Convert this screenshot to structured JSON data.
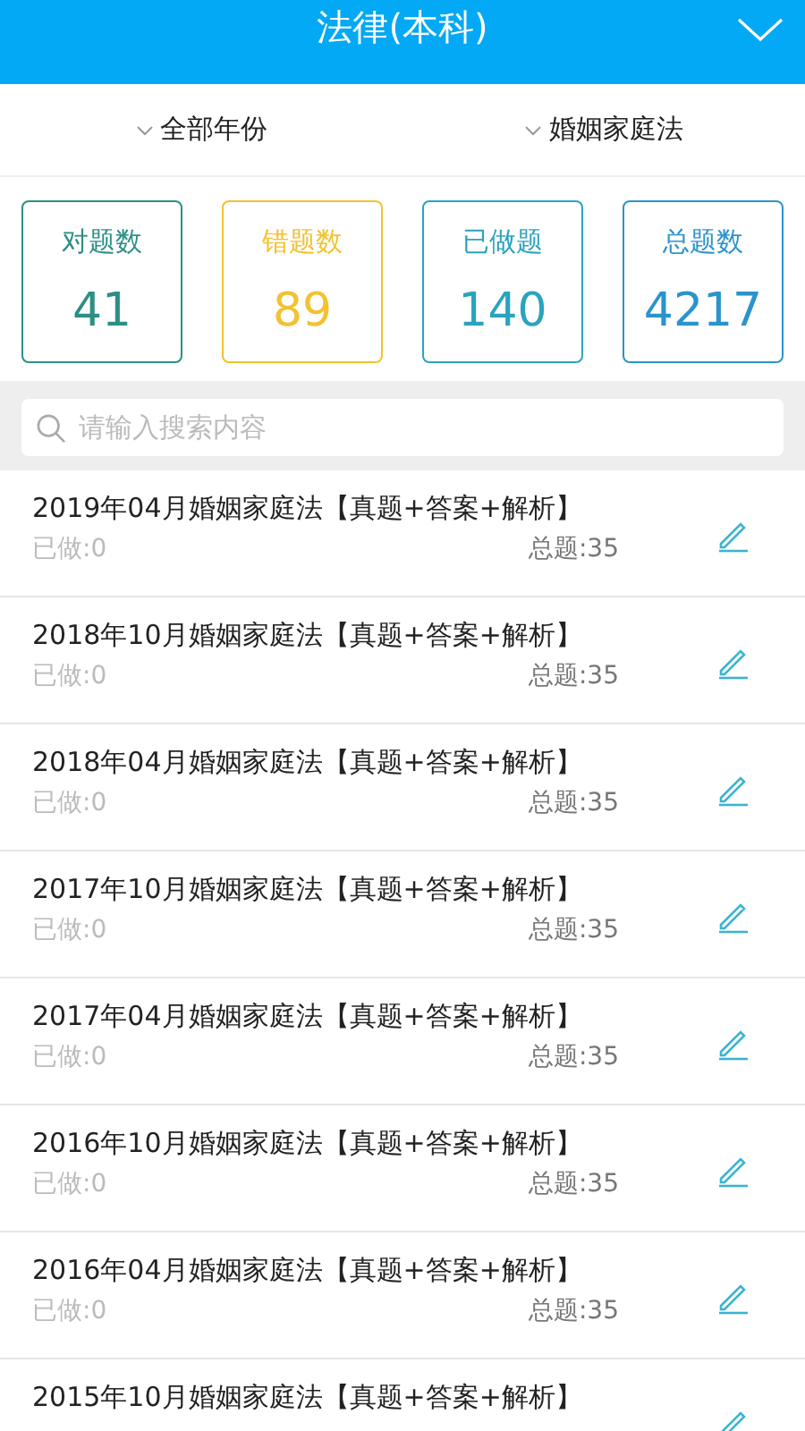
{
  "header": {
    "title": "法律(本科)"
  },
  "filters": [
    {
      "label": "全部年份"
    },
    {
      "label": "婚姻家庭法"
    }
  ],
  "stats": [
    {
      "label": "对题数",
      "value": "41",
      "color": "#2b8f86"
    },
    {
      "label": "错题数",
      "value": "89",
      "color": "#f2c230"
    },
    {
      "label": "已做题",
      "value": "140",
      "color": "#2aa3bd"
    },
    {
      "label": "总题数",
      "value": "4217",
      "color": "#2b93cc"
    }
  ],
  "search": {
    "placeholder": "请输入搜索内容"
  },
  "papers": [
    {
      "title": "2019年04月婚姻家庭法【真题+答案+解析】",
      "done": "已做:0",
      "total": "总题:35"
    },
    {
      "title": "2018年10月婚姻家庭法【真题+答案+解析】",
      "done": "已做:0",
      "total": "总题:35"
    },
    {
      "title": "2018年04月婚姻家庭法【真题+答案+解析】",
      "done": "已做:0",
      "total": "总题:35"
    },
    {
      "title": "2017年10月婚姻家庭法【真题+答案+解析】",
      "done": "已做:0",
      "total": "总题:35"
    },
    {
      "title": "2017年04月婚姻家庭法【真题+答案+解析】",
      "done": "已做:0",
      "total": "总题:35"
    },
    {
      "title": "2016年10月婚姻家庭法【真题+答案+解析】",
      "done": "已做:0",
      "total": "总题:35"
    },
    {
      "title": "2016年04月婚姻家庭法【真题+答案+解析】",
      "done": "已做:0",
      "total": "总题:35"
    },
    {
      "title": "2015年10月婚姻家庭法【真题+答案+解析】"
    }
  ]
}
